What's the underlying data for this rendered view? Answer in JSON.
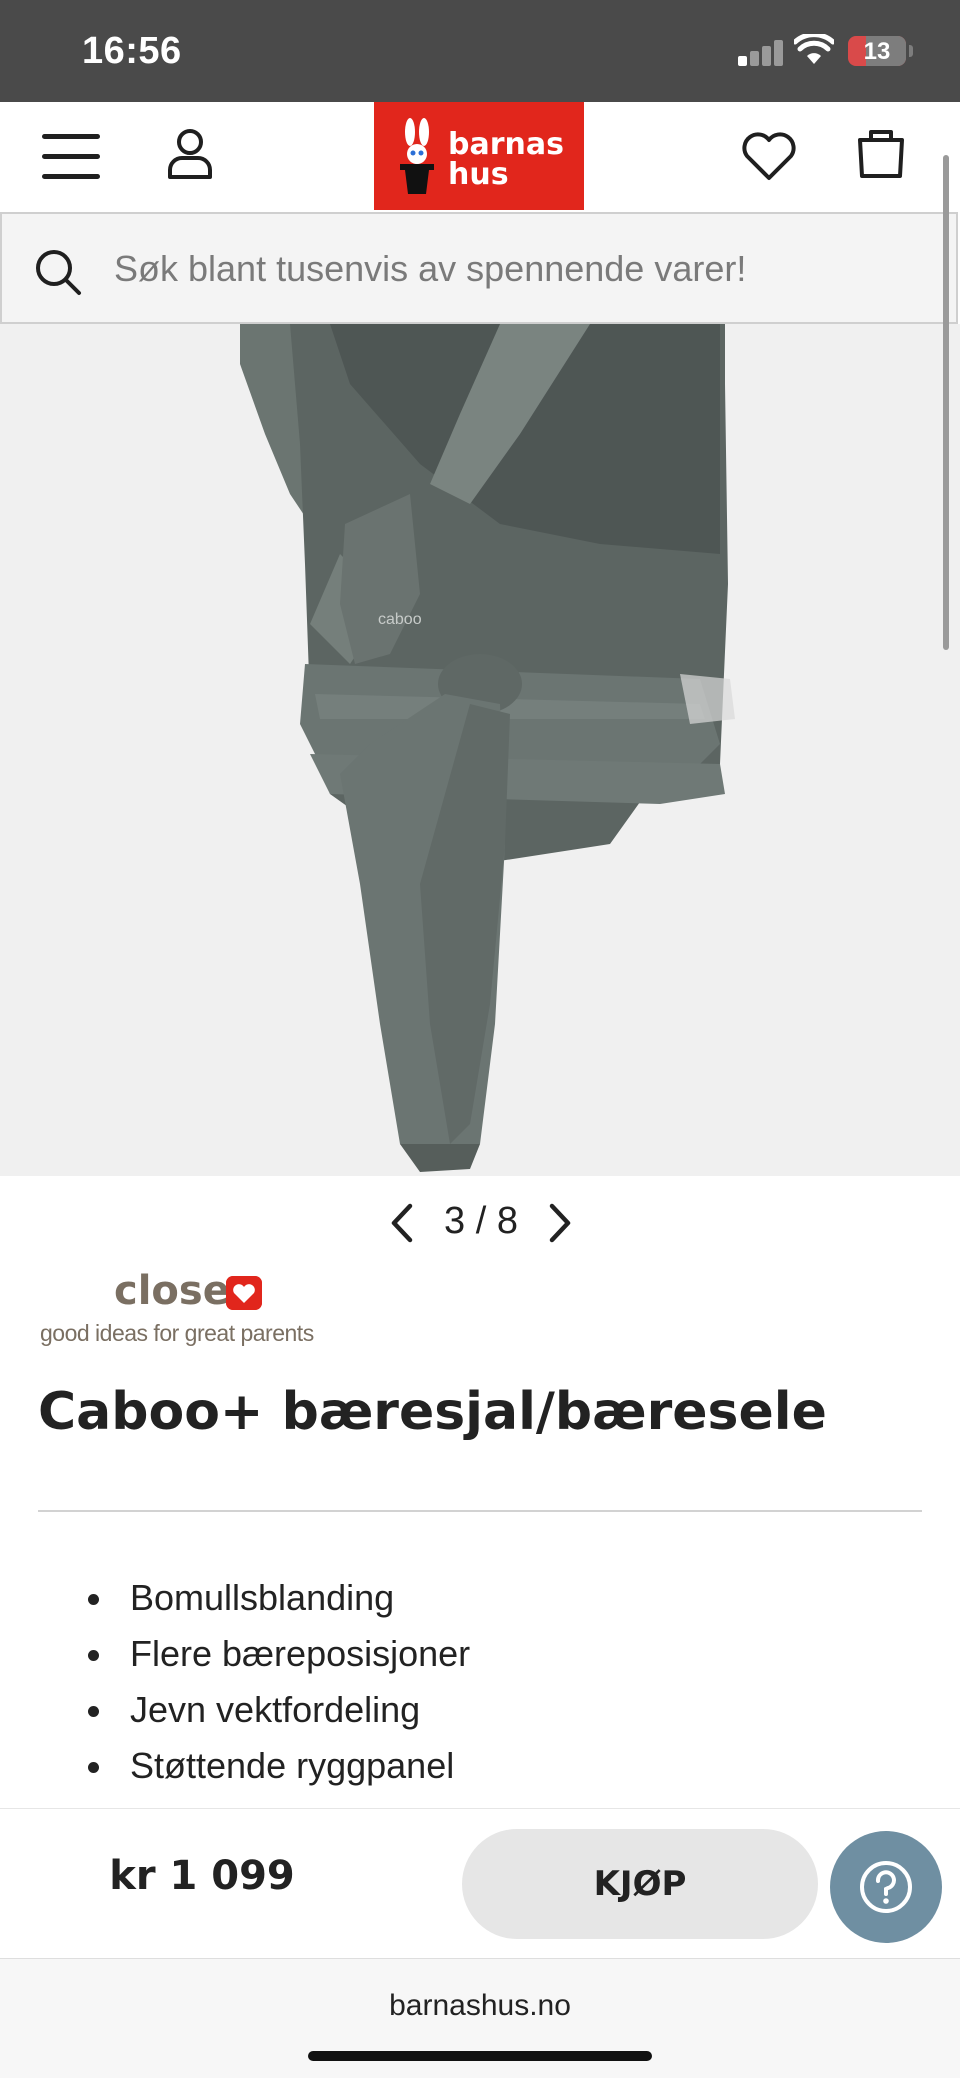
{
  "status_bar": {
    "time": "16:56",
    "battery": "13",
    "signal_bars_on": 1,
    "signal_bars_total": 4
  },
  "header": {
    "menu_icon": "menu-icon",
    "account_icon": "user-icon",
    "logo_text_line1": "barnas",
    "logo_text_line2": "hus",
    "wishlist_icon": "heart-icon",
    "cart_icon": "bag-icon",
    "brand_color": "#e1261c"
  },
  "search": {
    "placeholder": "Søk blant tusenvis av spennende varer!",
    "icon": "search-icon"
  },
  "gallery": {
    "image_alt": "Caboo+ bæresjal grå",
    "pager": "3 / 8"
  },
  "brand": {
    "name": "close",
    "tagline": "good ideas for great parents"
  },
  "product": {
    "title": "Caboo+ bæresjal/bæresele",
    "features": [
      "Bomullsblanding",
      "Flere bæreposisjoner",
      "Jevn vektfordeling",
      "Støttende ryggpanel"
    ],
    "price": "kr 1 099",
    "buy_label": "KJØP"
  },
  "help": {
    "icon": "question-icon",
    "color": "#6f8fa2"
  },
  "browser": {
    "url": "barnashus.no"
  }
}
